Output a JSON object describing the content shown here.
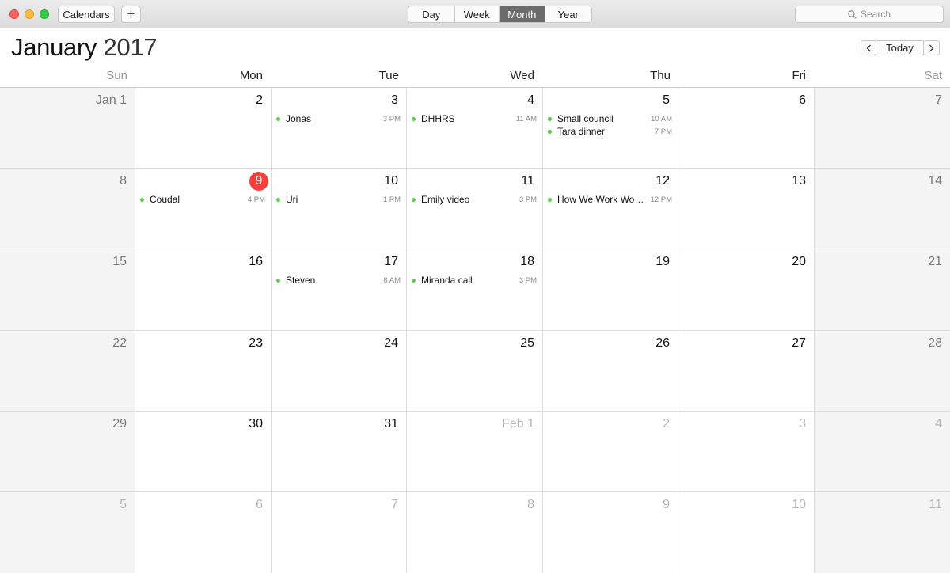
{
  "toolbar": {
    "calendars_label": "Calendars",
    "add_label": "+",
    "views": [
      "Day",
      "Week",
      "Month",
      "Year"
    ],
    "active_view": "Month",
    "search_placeholder": "Search"
  },
  "header": {
    "month": "January",
    "year": "2017",
    "today_label": "Today",
    "prev_label": "‹",
    "next_label": "›"
  },
  "weekdays": [
    "Sun",
    "Mon",
    "Tue",
    "Wed",
    "Thu",
    "Fri",
    "Sat"
  ],
  "today": "9",
  "colors": {
    "event_dot": "#5fca4f",
    "today_badge": "#fc3d39"
  },
  "weeks": [
    [
      {
        "label": "Jan 1",
        "other": false,
        "events": []
      },
      {
        "label": "2",
        "other": false,
        "events": []
      },
      {
        "label": "3",
        "other": false,
        "events": [
          {
            "name": "Jonas",
            "time": "3 PM"
          }
        ]
      },
      {
        "label": "4",
        "other": false,
        "events": [
          {
            "name": "DHHRS",
            "time": "11 AM"
          }
        ]
      },
      {
        "label": "5",
        "other": false,
        "events": [
          {
            "name": "Small council",
            "time": "10 AM"
          },
          {
            "name": "Tara dinner",
            "time": "7 PM"
          }
        ]
      },
      {
        "label": "6",
        "other": false,
        "events": []
      },
      {
        "label": "7",
        "other": false,
        "events": []
      }
    ],
    [
      {
        "label": "8",
        "other": false,
        "events": []
      },
      {
        "label": "9",
        "other": false,
        "events": [
          {
            "name": "Coudal",
            "time": "4 PM"
          }
        ]
      },
      {
        "label": "10",
        "other": false,
        "events": [
          {
            "name": "Uri",
            "time": "1 PM"
          }
        ]
      },
      {
        "label": "11",
        "other": false,
        "events": [
          {
            "name": "Emily video",
            "time": "3 PM"
          }
        ]
      },
      {
        "label": "12",
        "other": false,
        "events": [
          {
            "name": "How We Work Wor…",
            "time": "12 PM"
          }
        ]
      },
      {
        "label": "13",
        "other": false,
        "events": []
      },
      {
        "label": "14",
        "other": false,
        "events": []
      }
    ],
    [
      {
        "label": "15",
        "other": false,
        "events": []
      },
      {
        "label": "16",
        "other": false,
        "events": []
      },
      {
        "label": "17",
        "other": false,
        "events": [
          {
            "name": "Steven",
            "time": "8 AM"
          }
        ]
      },
      {
        "label": "18",
        "other": false,
        "events": [
          {
            "name": "Miranda call",
            "time": "3 PM"
          }
        ]
      },
      {
        "label": "19",
        "other": false,
        "events": []
      },
      {
        "label": "20",
        "other": false,
        "events": []
      },
      {
        "label": "21",
        "other": false,
        "events": []
      }
    ],
    [
      {
        "label": "22",
        "other": false,
        "events": []
      },
      {
        "label": "23",
        "other": false,
        "events": []
      },
      {
        "label": "24",
        "other": false,
        "events": []
      },
      {
        "label": "25",
        "other": false,
        "events": []
      },
      {
        "label": "26",
        "other": false,
        "events": []
      },
      {
        "label": "27",
        "other": false,
        "events": []
      },
      {
        "label": "28",
        "other": false,
        "events": []
      }
    ],
    [
      {
        "label": "29",
        "other": false,
        "events": []
      },
      {
        "label": "30",
        "other": false,
        "events": []
      },
      {
        "label": "31",
        "other": false,
        "events": []
      },
      {
        "label": "Feb 1",
        "other": true,
        "events": []
      },
      {
        "label": "2",
        "other": true,
        "events": []
      },
      {
        "label": "3",
        "other": true,
        "events": []
      },
      {
        "label": "4",
        "other": true,
        "events": []
      }
    ],
    [
      {
        "label": "5",
        "other": true,
        "events": []
      },
      {
        "label": "6",
        "other": true,
        "events": []
      },
      {
        "label": "7",
        "other": true,
        "events": []
      },
      {
        "label": "8",
        "other": true,
        "events": []
      },
      {
        "label": "9",
        "other": true,
        "events": []
      },
      {
        "label": "10",
        "other": true,
        "events": []
      },
      {
        "label": "11",
        "other": true,
        "events": []
      }
    ]
  ]
}
